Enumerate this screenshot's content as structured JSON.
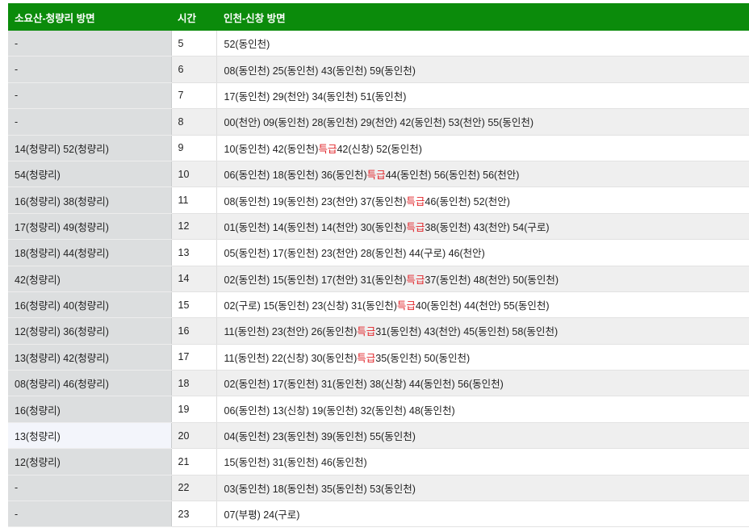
{
  "colors": {
    "header_bg": "#0b8b0b",
    "header_text": "#ffffff",
    "express": "#e0262b",
    "col1_bg": "#dcdedf",
    "row_alt": "#efefef",
    "row_highlight": "#f3f5fb"
  },
  "express_label": "특급",
  "header": {
    "inbound": "소요산-청량리 방면",
    "hour": "시간",
    "outbound": "인천-신창 방면"
  },
  "rows": [
    {
      "inbound": "-",
      "hour": "5",
      "outbound": [
        {
          "text": "52(동인천)"
        }
      ]
    },
    {
      "inbound": "-",
      "hour": "6",
      "outbound": [
        {
          "text": "08(동인천)"
        },
        {
          "text": "25(동인천)"
        },
        {
          "text": "43(동인천)"
        },
        {
          "text": "59(동인천)"
        }
      ]
    },
    {
      "inbound": "-",
      "hour": "7",
      "outbound": [
        {
          "text": "17(동인천)"
        },
        {
          "text": "29(천안)"
        },
        {
          "text": "34(동인천)"
        },
        {
          "text": "51(동인천)"
        }
      ]
    },
    {
      "inbound": "-",
      "hour": "8",
      "outbound": [
        {
          "text": "00(천안)"
        },
        {
          "text": "09(동인천)"
        },
        {
          "text": "28(동인천)"
        },
        {
          "text": "29(천안)"
        },
        {
          "text": "42(동인천)"
        },
        {
          "text": "53(천안)"
        },
        {
          "text": "55(동인천)"
        }
      ]
    },
    {
      "inbound": "14(청량리) 52(청량리)",
      "hour": "9",
      "outbound": [
        {
          "text": "10(동인천)"
        },
        {
          "text": "42(동인천)"
        },
        {
          "text": "42(신창)",
          "express": true
        },
        {
          "text": "52(동인천)"
        }
      ]
    },
    {
      "inbound": "54(청량리)",
      "hour": "10",
      "outbound": [
        {
          "text": "06(동인천)"
        },
        {
          "text": "18(동인천)"
        },
        {
          "text": "36(동인천)"
        },
        {
          "text": "44(동인천)",
          "express": true
        },
        {
          "text": "56(동인천)"
        },
        {
          "text": "56(천안)"
        }
      ]
    },
    {
      "inbound": "16(청량리) 38(청량리)",
      "hour": "11",
      "outbound": [
        {
          "text": "08(동인천)"
        },
        {
          "text": "19(동인천)"
        },
        {
          "text": "23(천안)"
        },
        {
          "text": "37(동인천)"
        },
        {
          "text": "46(동인천)",
          "express": true
        },
        {
          "text": "52(천안)"
        }
      ]
    },
    {
      "inbound": "17(청량리) 49(청량리)",
      "hour": "12",
      "outbound": [
        {
          "text": "01(동인천)"
        },
        {
          "text": "14(동인천)"
        },
        {
          "text": "14(천안)"
        },
        {
          "text": "30(동인천)"
        },
        {
          "text": "38(동인천)",
          "express": true
        },
        {
          "text": "43(천안)"
        },
        {
          "text": "54(구로)"
        }
      ]
    },
    {
      "inbound": "18(청량리) 44(청량리)",
      "hour": "13",
      "outbound": [
        {
          "text": "05(동인천)"
        },
        {
          "text": "17(동인천)"
        },
        {
          "text": "23(천안)"
        },
        {
          "text": "28(동인천)"
        },
        {
          "text": "44(구로)"
        },
        {
          "text": "46(천안)"
        }
      ]
    },
    {
      "inbound": "42(청량리)",
      "hour": "14",
      "outbound": [
        {
          "text": "02(동인천)"
        },
        {
          "text": "15(동인천)"
        },
        {
          "text": "17(천안)"
        },
        {
          "text": "31(동인천)"
        },
        {
          "text": "37(동인천)",
          "express": true
        },
        {
          "text": "48(천안)"
        },
        {
          "text": "50(동인천)"
        }
      ]
    },
    {
      "inbound": "16(청량리) 40(청량리)",
      "hour": "15",
      "outbound": [
        {
          "text": "02(구로)"
        },
        {
          "text": "15(동인천)"
        },
        {
          "text": "23(신창)"
        },
        {
          "text": "31(동인천)"
        },
        {
          "text": "40(동인천)",
          "express": true
        },
        {
          "text": "44(천안)"
        },
        {
          "text": "55(동인천)"
        }
      ]
    },
    {
      "inbound": "12(청량리) 36(청량리)",
      "hour": "16",
      "outbound": [
        {
          "text": "11(동인천)"
        },
        {
          "text": "23(천안)"
        },
        {
          "text": "26(동인천)"
        },
        {
          "text": "31(동인천)",
          "express": true
        },
        {
          "text": "43(천안)"
        },
        {
          "text": "45(동인천)"
        },
        {
          "text": "58(동인천)"
        }
      ]
    },
    {
      "inbound": "13(청량리) 42(청량리)",
      "hour": "17",
      "outbound": [
        {
          "text": "11(동인천)"
        },
        {
          "text": "22(신창)"
        },
        {
          "text": "30(동인천)"
        },
        {
          "text": "35(동인천)",
          "express": true
        },
        {
          "text": "50(동인천)"
        }
      ]
    },
    {
      "inbound": "08(청량리) 46(청량리)",
      "hour": "18",
      "outbound": [
        {
          "text": "02(동인천)"
        },
        {
          "text": "17(동인천)"
        },
        {
          "text": "31(동인천)"
        },
        {
          "text": "38(신창)"
        },
        {
          "text": "44(동인천)"
        },
        {
          "text": "56(동인천)"
        }
      ]
    },
    {
      "inbound": "16(청량리)",
      "hour": "19",
      "outbound": [
        {
          "text": "06(동인천)"
        },
        {
          "text": "13(신창)"
        },
        {
          "text": "19(동인천)"
        },
        {
          "text": "32(동인천)"
        },
        {
          "text": "48(동인천)"
        }
      ]
    },
    {
      "inbound": "13(청량리)",
      "hour": "20",
      "highlighted": true,
      "outbound": [
        {
          "text": "04(동인천)"
        },
        {
          "text": "23(동인천)"
        },
        {
          "text": "39(동인천)"
        },
        {
          "text": "55(동인천)"
        }
      ]
    },
    {
      "inbound": "12(청량리)",
      "hour": "21",
      "outbound": [
        {
          "text": "15(동인천)"
        },
        {
          "text": "31(동인천)"
        },
        {
          "text": "46(동인천)"
        }
      ]
    },
    {
      "inbound": "-",
      "hour": "22",
      "outbound": [
        {
          "text": "03(동인천)"
        },
        {
          "text": "18(동인천)"
        },
        {
          "text": "35(동인천)"
        },
        {
          "text": "53(동인천)"
        }
      ]
    },
    {
      "inbound": "-",
      "hour": "23",
      "outbound": [
        {
          "text": "07(부평)"
        },
        {
          "text": "24(구로)"
        }
      ]
    }
  ]
}
